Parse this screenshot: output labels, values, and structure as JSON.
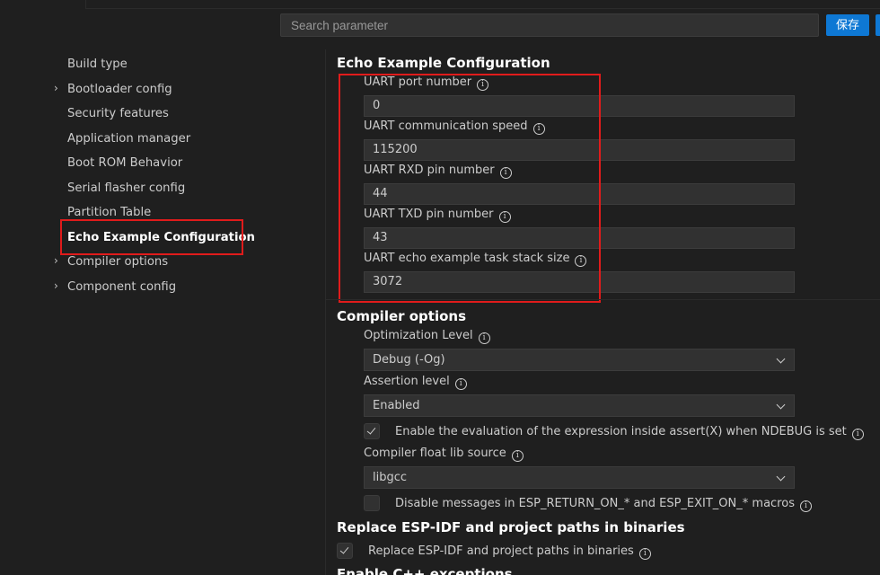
{
  "search": {
    "placeholder": "Search parameter"
  },
  "toolbar": {
    "save_label": "保存"
  },
  "sidebar": {
    "items": [
      {
        "label": "Build type",
        "expandable": false,
        "active": false
      },
      {
        "label": "Bootloader config",
        "expandable": true,
        "active": false
      },
      {
        "label": "Security features",
        "expandable": false,
        "active": false
      },
      {
        "label": "Application manager",
        "expandable": false,
        "active": false
      },
      {
        "label": "Boot ROM Behavior",
        "expandable": false,
        "active": false
      },
      {
        "label": "Serial flasher config",
        "expandable": false,
        "active": false
      },
      {
        "label": "Partition Table",
        "expandable": false,
        "active": false
      },
      {
        "label": "Echo Example Configuration",
        "expandable": false,
        "active": true
      },
      {
        "label": "Compiler options",
        "expandable": true,
        "active": false
      },
      {
        "label": "Component config",
        "expandable": true,
        "active": false
      }
    ]
  },
  "echo": {
    "title": "Echo Example Configuration",
    "fields": [
      {
        "label": "UART port number",
        "value": "0"
      },
      {
        "label": "UART communication speed",
        "value": "115200"
      },
      {
        "label": "UART RXD pin number",
        "value": "44"
      },
      {
        "label": "UART TXD pin number",
        "value": "43"
      },
      {
        "label": "UART echo example task stack size",
        "value": "3072"
      }
    ]
  },
  "compiler": {
    "title": "Compiler options",
    "opt_label": "Optimization Level",
    "opt_value": "Debug (-Og)",
    "assert_label": "Assertion level",
    "assert_value": "Enabled",
    "assert_eval_label": "Enable the evaluation of the expression inside assert(X) when NDEBUG is set",
    "assert_eval_checked": true,
    "float_label": "Compiler float lib source",
    "float_value": "libgcc",
    "disable_msgs_label": "Disable messages in ESP_RETURN_ON_* and ESP_EXIT_ON_* macros",
    "disable_msgs_checked": false
  },
  "replace": {
    "title": "Replace ESP-IDF and project paths in binaries",
    "check_label": "Replace ESP-IDF and project paths in binaries",
    "checked": true
  },
  "next_section": {
    "title": "Enable C++ exceptions"
  },
  "colors": {
    "highlight": "#e01b1b",
    "accent": "#0e78d4",
    "background": "#1f1f1f"
  }
}
